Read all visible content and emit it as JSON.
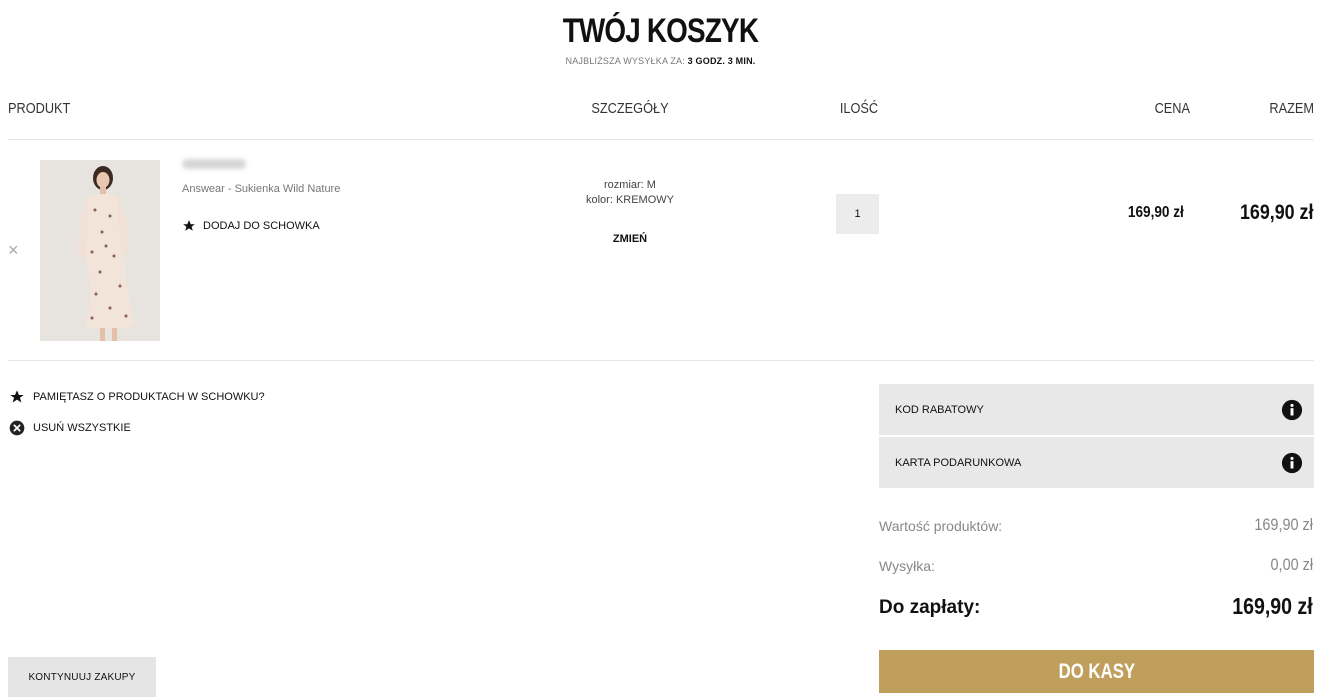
{
  "header": {
    "title": "TWÓJ KOSZYK",
    "shipping_label": "NAJBLIŻSZA WYSYŁKA ZA:",
    "shipping_time": "3 GODZ. 3 MIN."
  },
  "columns": {
    "product": "PRODUKT",
    "details": "SZCZEGÓŁY",
    "quantity": "ILOŚĆ",
    "price": "CENA",
    "total": "RAZEM"
  },
  "cart_item": {
    "remove_symbol": "×",
    "name": "Answear - Sukienka Wild Nature",
    "add_to_favorites": "DODAJ DO SCHOWKA",
    "size": "rozmiar: M",
    "color": "kolor: KREMOWY",
    "change": "ZMIEŃ",
    "quantity": "1",
    "price": "169,90 zł",
    "total": "169,90 zł"
  },
  "actions": {
    "favorites_reminder": "PAMIĘTASZ O PRODUKTACH W SCHOWKU?",
    "remove_all": "USUŃ WSZYSTKIE",
    "continue_shopping": "KONTYNUUJ ZAKUPY"
  },
  "summary": {
    "discount_code": "KOD RABATOWY",
    "gift_card": "KARTA PODARUNKOWA",
    "products_value_label": "Wartość produktów:",
    "products_value": "169,90 zł",
    "shipping_label": "Wysyłka:",
    "shipping_value": "0,00 zł",
    "total_label": "Do zapłaty:",
    "total_value": "169,90 zł",
    "checkout": "DO KASY"
  },
  "colors": {
    "accent_gold": "#c09f5c",
    "panel_gray": "#e8e8e8"
  },
  "icons": [
    "star-icon",
    "remove-circle-icon",
    "info-icon",
    "close-icon"
  ]
}
